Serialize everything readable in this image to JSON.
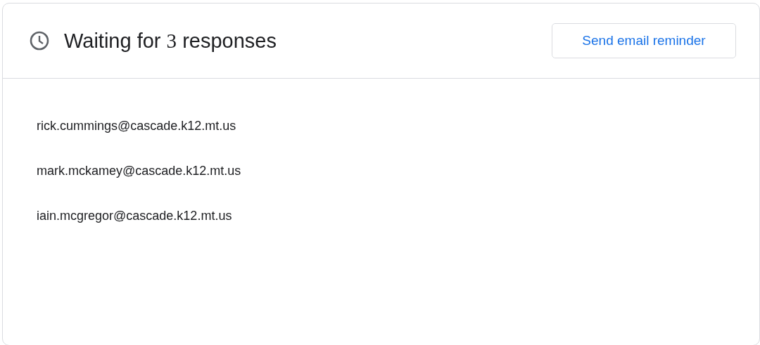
{
  "header": {
    "title": {
      "before": "Waiting for",
      "count": "3",
      "after": "responses"
    },
    "button": "Send email reminder"
  },
  "recipients": [
    "rick.cummings@cascade.k12.mt.us",
    "mark.mckamey@cascade.k12.mt.us",
    "iain.mcgregor@cascade.k12.mt.us"
  ]
}
